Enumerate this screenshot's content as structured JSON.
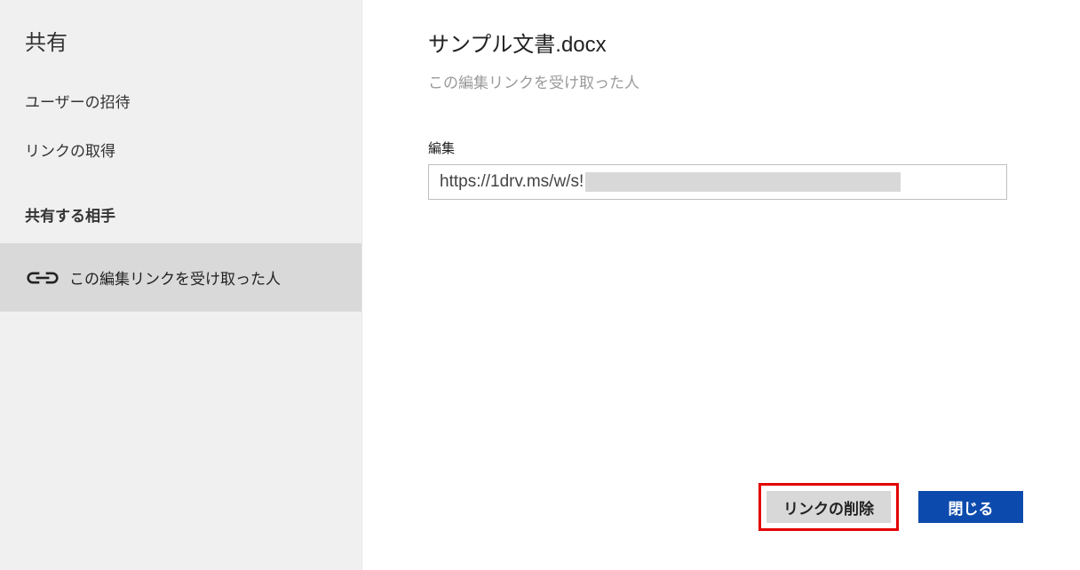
{
  "sidebar": {
    "title": "共有",
    "menu": {
      "invite": "ユーザーの招待",
      "getLink": "リンクの取得"
    },
    "sectionLabel": "共有する相手",
    "sharedItem": {
      "label": "この編集リンクを受け取った人"
    }
  },
  "main": {
    "docTitle": "サンプル文書.docx",
    "subtitle": "この編集リンクを受け取った人",
    "fieldLabel": "編集",
    "url": "https://1drv.ms/w/s!"
  },
  "footer": {
    "deleteLink": "リンクの削除",
    "close": "閉じる"
  }
}
